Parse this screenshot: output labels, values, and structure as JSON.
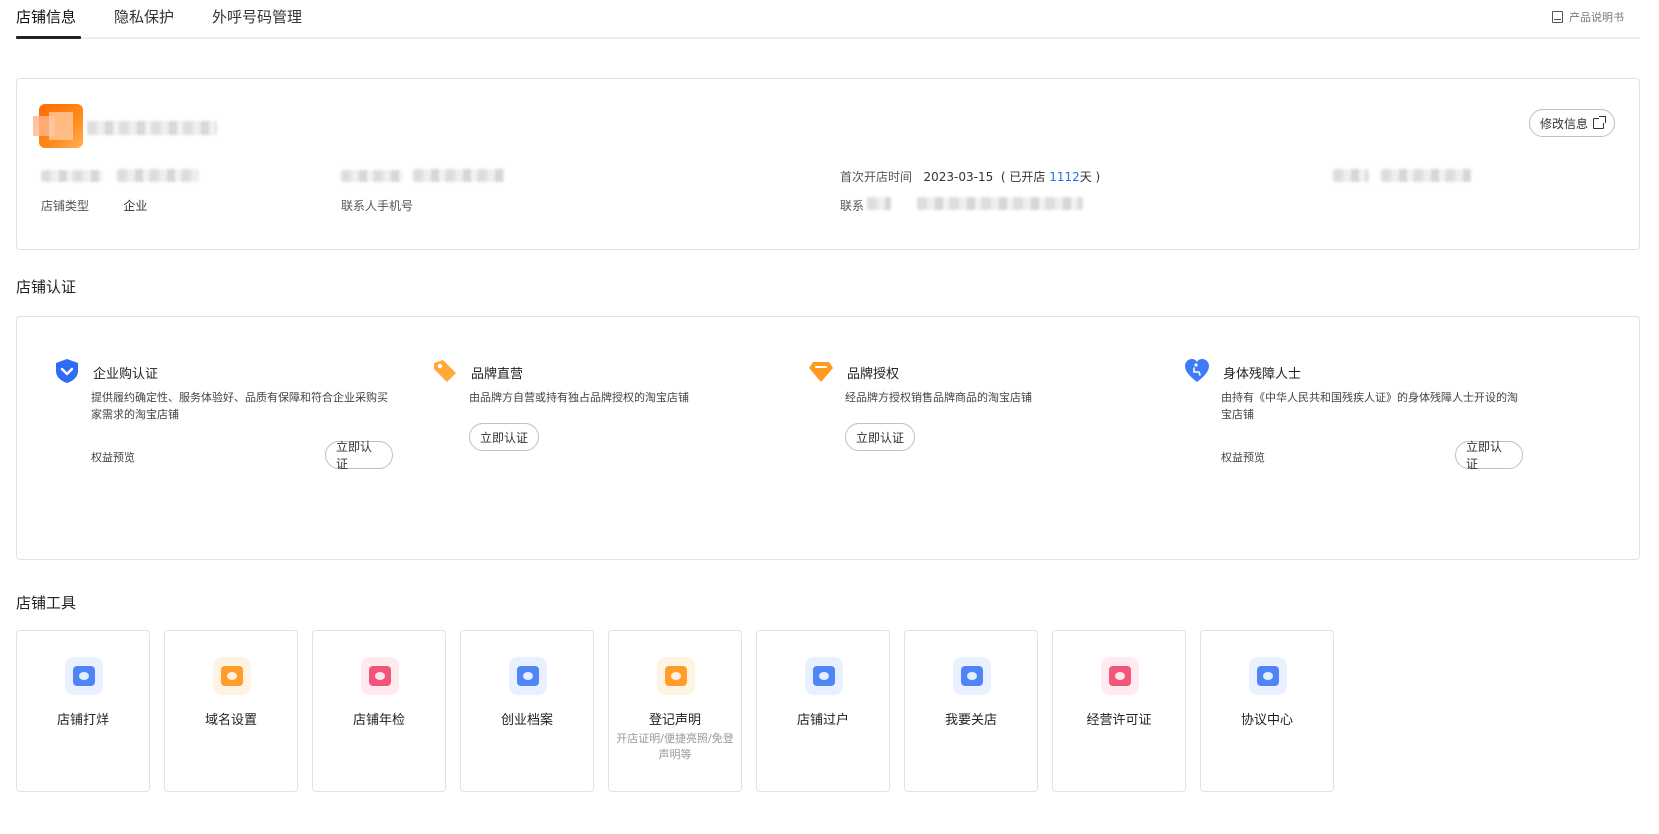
{
  "tabs": [
    {
      "label": "店铺信息"
    },
    {
      "label": "隐私保护"
    },
    {
      "label": "外呼号码管理"
    }
  ],
  "manual": {
    "label": "产品说明书",
    "icon": "book-icon"
  },
  "shop_info": {
    "edit_label": "修改信息",
    "open_date_label": "首次开店时间",
    "open_date_value": "2023-03-15",
    "days_prefix": "( 已开店",
    "days_value": "1112",
    "days_suffix": "天 )",
    "shop_type_label": "店铺类型",
    "shop_type_value": "企业",
    "contact_phone_label": "联系人手机号",
    "contact_label": "联系"
  },
  "certification": {
    "title": "店铺认证",
    "items": [
      {
        "title": "企业购认证",
        "desc": "提供履约确定性、服务体验好、品质有保障和符合企业采购买家需求的淘宝店铺",
        "rights": "权益预览",
        "button": "立即认证",
        "icon": "shield-check-icon"
      },
      {
        "title": "品牌直营",
        "desc": "由品牌方自营或持有独占品牌授权的淘宝店铺",
        "button": "立即认证",
        "icon": "tag-icon"
      },
      {
        "title": "品牌授权",
        "desc": "经品牌方授权销售品牌商品的淘宝店铺",
        "button": "立即认证",
        "icon": "diamond-icon"
      },
      {
        "title": "身体残障人士",
        "desc": "由持有《中华人民共和国残疾人证》的身体残障人士开设的淘宝店铺",
        "rights": "权益预览",
        "button": "立即认证",
        "icon": "heart-accessibility-icon"
      }
    ]
  },
  "tools": {
    "title": "店铺工具",
    "items": [
      {
        "label": "店铺打烊",
        "sub": "",
        "icon": "shop-close-icon",
        "color": "blue"
      },
      {
        "label": "域名设置",
        "sub": "",
        "icon": "domain-icon",
        "color": "orange"
      },
      {
        "label": "店铺年检",
        "sub": "",
        "icon": "inspection-shield-icon",
        "color": "red"
      },
      {
        "label": "创业档案",
        "sub": "",
        "icon": "archive-icon",
        "color": "blue"
      },
      {
        "label": "登记声明",
        "sub": "开店证明/便捷亮照/免登声明等",
        "icon": "statement-icon",
        "color": "orange"
      },
      {
        "label": "店铺过户",
        "sub": "",
        "icon": "transfer-icon",
        "color": "blue"
      },
      {
        "label": "我要关店",
        "sub": "",
        "icon": "close-shop-icon",
        "color": "blue"
      },
      {
        "label": "经营许可证",
        "sub": "",
        "icon": "license-folder-icon",
        "color": "red"
      },
      {
        "label": "协议中心",
        "sub": "",
        "icon": "agreement-icon",
        "color": "blue"
      }
    ]
  },
  "colors": {
    "accent": "#2c6cf6",
    "brand_orange": "#ff6a00"
  }
}
